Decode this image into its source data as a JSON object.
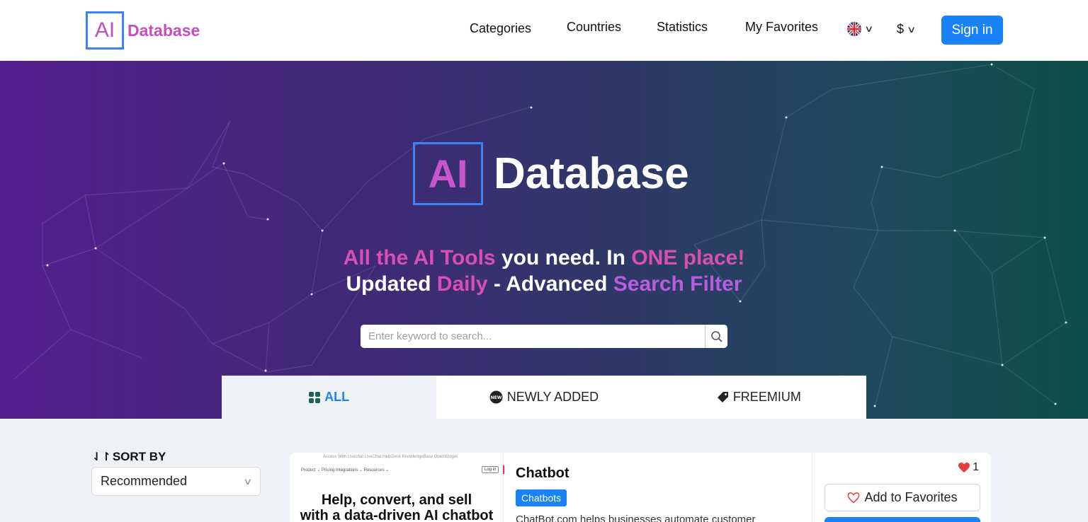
{
  "brand": {
    "logo_mark": "AI",
    "logo_text": "Database"
  },
  "nav": {
    "items": [
      "Categories",
      "Countries",
      "Statistics",
      "My Favorites"
    ],
    "language_icon": "uk-flag-icon",
    "currency_symbol": "$",
    "signin_label": "Sign in"
  },
  "hero": {
    "logo_mark": "AI",
    "logo_text": "Database",
    "tagline1": {
      "p1": "All the AI Tools",
      "p2": " you need. In ",
      "p3": "ONE place!"
    },
    "tagline2": {
      "p1": "Updated ",
      "p2": "Daily",
      "p3": " - Advanced ",
      "p4": "Search Filter"
    },
    "search_placeholder": "Enter keyword to search..."
  },
  "tabs": [
    {
      "label": "ALL",
      "icon": "grid-icon",
      "active": true
    },
    {
      "label": "NEWLY ADDED",
      "icon": "new-badge-icon",
      "active": false
    },
    {
      "label": "FREEMIUM",
      "icon": "tag-icon",
      "active": false
    }
  ],
  "sort": {
    "label": "SORT BY",
    "selected": "Recommended"
  },
  "card": {
    "title": "Chatbot",
    "category": "Chatbots",
    "description": "ChatBot.com helps businesses automate customer",
    "likes": "1",
    "favorite_label": "Add to Favorites",
    "thumbnail": {
      "topbar": "Access With Livechat    LiveChat    HelpDesk    KnowledgeBase    OpenWidget",
      "nav": "Product ⌄      Pricing      Integrations ⌄      Resources ⌄",
      "login": "Log in",
      "headline1": "Help, convert, and sell",
      "headline2": "with a data-driven AI chatbot"
    }
  },
  "colors": {
    "accent": "#1a82f7",
    "brand_pink": "#c24fc0",
    "hero_start": "#55208f",
    "hero_end": "#0f4e48"
  }
}
